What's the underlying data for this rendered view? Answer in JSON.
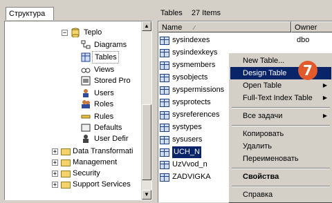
{
  "left_panel": {
    "tab_label": "Структура",
    "tree": [
      {
        "label": "Teplo",
        "icon": "database-icon",
        "expander": "−"
      },
      {
        "label": "Diagrams",
        "icon": "diagram-icon"
      },
      {
        "label": "Tables",
        "icon": "table-icon",
        "selected": true
      },
      {
        "label": "Views",
        "icon": "view-icon"
      },
      {
        "label": "Stored Pro",
        "icon": "stored-procedure-icon"
      },
      {
        "label": "Users",
        "icon": "users-icon"
      },
      {
        "label": "Roles",
        "icon": "roles-icon"
      },
      {
        "label": "Rules",
        "icon": "rules-icon"
      },
      {
        "label": "Defaults",
        "icon": "defaults-icon"
      },
      {
        "label": "User Defir",
        "icon": "user-defined-icon"
      },
      {
        "label": "Data Transformati",
        "icon": "folder-icon",
        "expander": "+"
      },
      {
        "label": "Management",
        "icon": "folder-icon",
        "expander": "+"
      },
      {
        "label": "Security",
        "icon": "folder-icon",
        "expander": "+"
      },
      {
        "label": "Support Services",
        "icon": "folder-icon",
        "expander": "+"
      }
    ]
  },
  "right_panel": {
    "title": "Tables",
    "count": "27 Items",
    "columns": {
      "name": "Name",
      "owner": "Owner"
    },
    "rows": [
      {
        "name": "sysindexes",
        "owner": "dbo"
      },
      {
        "name": "sysindexkeys",
        "owner": ""
      },
      {
        "name": "sysmembers",
        "owner": ""
      },
      {
        "name": "sysobjects",
        "owner": ""
      },
      {
        "name": "syspermissions",
        "owner": ""
      },
      {
        "name": "sysprotects",
        "owner": ""
      },
      {
        "name": "sysreferences",
        "owner": ""
      },
      {
        "name": "systypes",
        "owner": ""
      },
      {
        "name": "sysusers",
        "owner": ""
      },
      {
        "name": "UCH_N",
        "owner": "",
        "selected": true
      },
      {
        "name": "UzVvod_n",
        "owner": ""
      },
      {
        "name": "ZADVIGKA",
        "owner": ""
      }
    ]
  },
  "context_menu": {
    "items": [
      {
        "label": "New Table..."
      },
      {
        "label": "Design Table",
        "highlighted": true
      },
      {
        "label": "Open Table",
        "submenu": true
      },
      {
        "label": "Full-Text Index Table",
        "submenu": true
      },
      {
        "label": "Все задачи",
        "submenu": true
      },
      {
        "label": "Копировать"
      },
      {
        "label": "Удалить"
      },
      {
        "label": "Переименовать"
      },
      {
        "label": "Свойства",
        "bold": true
      },
      {
        "label": "Справка"
      }
    ]
  },
  "callout_badge": "7",
  "colors": {
    "selection": "#0a246a",
    "badge": "#e35a2a",
    "window": "#d4d0c8"
  }
}
